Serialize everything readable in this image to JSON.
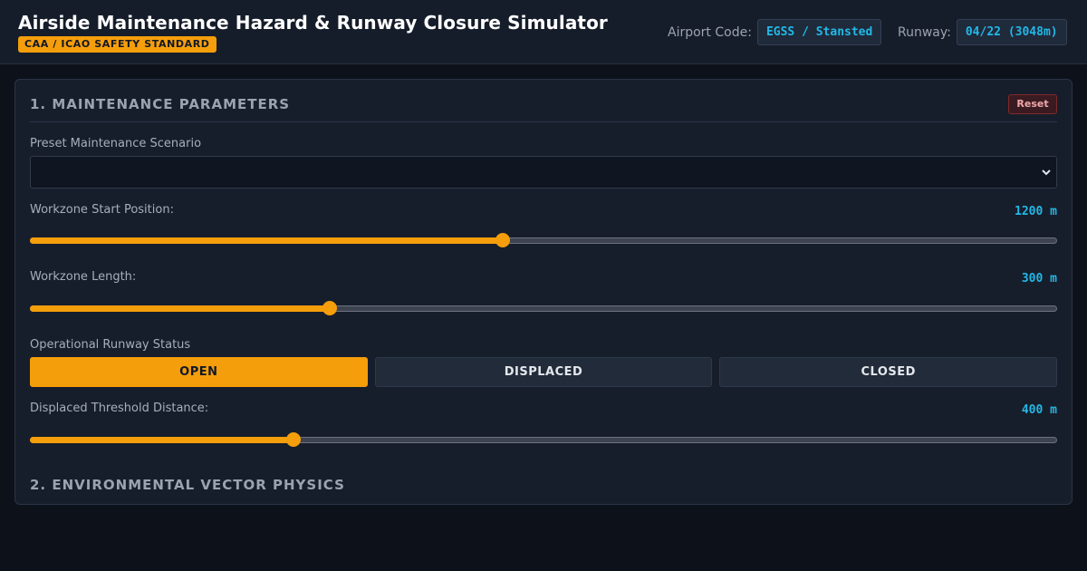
{
  "header": {
    "title": "Airside Maintenance Hazard & Runway Closure Simulator",
    "badge": "CAA / ICAO SAFETY STANDARD",
    "airport_label": "Airport Code:",
    "airport_value": "EGSS / Stansted",
    "runway_label": "Runway:",
    "runway_value": "04/22 (3048m)"
  },
  "section1": {
    "title": "1. MAINTENANCE PARAMETERS",
    "reset_label": "Reset",
    "preset_label": "Preset Maintenance Scenario",
    "preset_value": "",
    "start": {
      "label": "Workzone Start Position:",
      "value": "1200 m",
      "fraction": 0.46
    },
    "length": {
      "label": "Workzone Length:",
      "value": "300 m",
      "fraction": 0.292
    },
    "status": {
      "label": "Operational Runway Status",
      "options": [
        "OPEN",
        "DISPLACED",
        "CLOSED"
      ],
      "selected": "OPEN"
    },
    "threshold": {
      "label": "Displaced Threshold Distance:",
      "value": "400 m",
      "fraction": 0.257
    }
  },
  "section2": {
    "title": "2. ENVIRONMENTAL VECTOR PHYSICS"
  },
  "colors": {
    "accent": "#f59e0b",
    "readout": "#22b8e6",
    "danger": "#7f2a2a"
  }
}
